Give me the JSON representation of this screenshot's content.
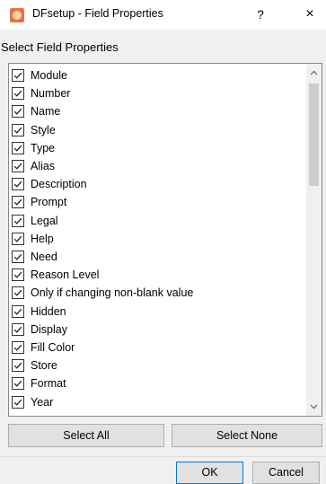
{
  "window": {
    "title": "DFsetup - Field Properties",
    "help_label": "?",
    "close_label": "×"
  },
  "section_label": "Select Field Properties",
  "fields": [
    {
      "label": "Module",
      "checked": true
    },
    {
      "label": "Number",
      "checked": true
    },
    {
      "label": "Name",
      "checked": true
    },
    {
      "label": "Style",
      "checked": true
    },
    {
      "label": "Type",
      "checked": true
    },
    {
      "label": "Alias",
      "checked": true
    },
    {
      "label": "Description",
      "checked": true
    },
    {
      "label": "Prompt",
      "checked": true
    },
    {
      "label": "Legal",
      "checked": true
    },
    {
      "label": "Help",
      "checked": true
    },
    {
      "label": "Need",
      "checked": true
    },
    {
      "label": "Reason Level",
      "checked": true
    },
    {
      "label": "Only if changing non-blank value",
      "checked": true
    },
    {
      "label": "Hidden",
      "checked": true
    },
    {
      "label": "Display",
      "checked": true
    },
    {
      "label": "Fill Color",
      "checked": true
    },
    {
      "label": "Store",
      "checked": true
    },
    {
      "label": "Format",
      "checked": true
    },
    {
      "label": "Year",
      "checked": true
    }
  ],
  "buttons": {
    "select_all": "Select All",
    "select_none": "Select None",
    "ok": "OK",
    "cancel": "Cancel"
  },
  "colors": {
    "app_icon": "#e8743b",
    "default_button_border": "#0078d7"
  }
}
